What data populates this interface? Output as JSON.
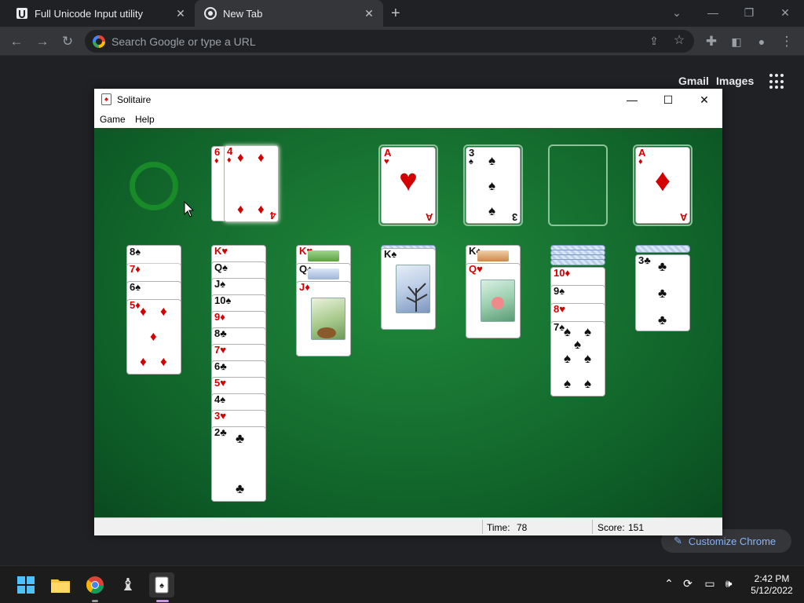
{
  "browser": {
    "tabs": [
      {
        "title": "Full Unicode Input utility",
        "active": false
      },
      {
        "title": "New Tab",
        "active": true
      }
    ],
    "omnibox_placeholder": "Search Google or type a URL",
    "ntp_links": {
      "gmail": "Gmail",
      "images": "Images"
    },
    "customize_label": "Customize Chrome"
  },
  "solitaire": {
    "title": "Solitaire",
    "menu": [
      "Game",
      "Help"
    ],
    "status": {
      "time_label": "Time:",
      "time_value": "78",
      "score_label": "Score:",
      "score_value": "151"
    },
    "waste": [
      {
        "rank": "6",
        "suit": "♦"
      },
      {
        "rank": "4",
        "suit": "♦"
      }
    ],
    "foundations": [
      {
        "rank": "A",
        "suit": "♥"
      },
      {
        "rank": "3",
        "suit": "♠"
      },
      {
        "rank": "",
        "suit": ""
      },
      {
        "rank": "A",
        "suit": "♦"
      }
    ],
    "tableau": [
      {
        "cards": [
          "8♠",
          "7♦",
          "6♠",
          "5♦"
        ]
      },
      {
        "cards": [
          "K♥",
          "Q♠",
          "J♠",
          "10♠",
          "9♦",
          "8♣",
          "7♥",
          "6♣",
          "5♥",
          "4♠",
          "3♥",
          "2♣"
        ]
      },
      {
        "cards": [
          "K♥",
          "Q♠",
          "J♦"
        ]
      },
      {
        "cards": [
          "K♠"
        ]
      },
      {
        "cards": [
          "K♠",
          "Q♥"
        ]
      },
      {
        "cards": [
          "10♦",
          "9♠",
          "8♥",
          "7♠"
        ]
      },
      {
        "cards": [
          "3♣"
        ]
      }
    ]
  },
  "taskbar": {
    "time": "2:42 PM",
    "date": "5/12/2022"
  }
}
